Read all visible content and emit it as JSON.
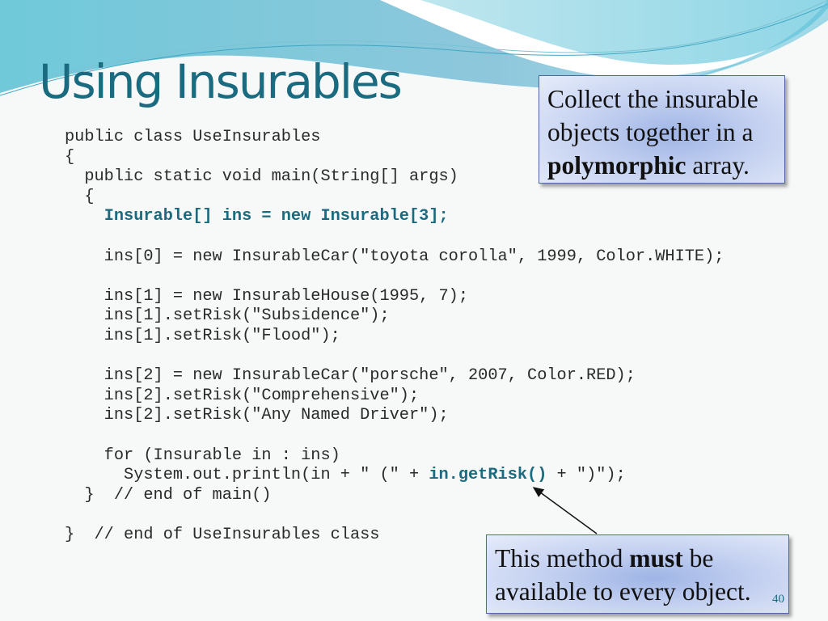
{
  "slide": {
    "title": "Using Insurables",
    "page_number": "40",
    "accent_color": "#1a6a80"
  },
  "code": {
    "lines": [
      {
        "pre": "public class UseInsurables",
        "hl": "",
        "post": ""
      },
      {
        "pre": "{",
        "hl": "",
        "post": ""
      },
      {
        "pre": "  public static void main(String[] args)",
        "hl": "",
        "post": ""
      },
      {
        "pre": "  {",
        "hl": "",
        "post": ""
      },
      {
        "pre": "    ",
        "hl": "Insurable[] ins = new Insurable[3];",
        "post": ""
      },
      {
        "pre": "",
        "hl": "",
        "post": ""
      },
      {
        "pre": "    ins[0] = new InsurableCar(\"toyota corolla\", 1999, Color.WHITE);",
        "hl": "",
        "post": ""
      },
      {
        "pre": "",
        "hl": "",
        "post": ""
      },
      {
        "pre": "    ins[1] = new InsurableHouse(1995, 7);",
        "hl": "",
        "post": ""
      },
      {
        "pre": "    ins[1].setRisk(\"Subsidence\");",
        "hl": "",
        "post": ""
      },
      {
        "pre": "    ins[1].setRisk(\"Flood\");",
        "hl": "",
        "post": ""
      },
      {
        "pre": "",
        "hl": "",
        "post": ""
      },
      {
        "pre": "    ins[2] = new InsurableCar(\"porsche\", 2007, Color.RED);",
        "hl": "",
        "post": ""
      },
      {
        "pre": "    ins[2].setRisk(\"Comprehensive\");",
        "hl": "",
        "post": ""
      },
      {
        "pre": "    ins[2].setRisk(\"Any Named Driver\");",
        "hl": "",
        "post": ""
      },
      {
        "pre": "",
        "hl": "",
        "post": ""
      },
      {
        "pre": "    for (Insurable in : ins)",
        "hl": "",
        "post": ""
      },
      {
        "pre": "      System.out.println(in + \" (\" + ",
        "hl": "in.getRisk()",
        "post": " + \")\");"
      },
      {
        "pre": "  }  // end of main()",
        "hl": "",
        "post": ""
      },
      {
        "pre": "",
        "hl": "",
        "post": ""
      },
      {
        "pre": "}  // end of UseInsurables class",
        "hl": "",
        "post": ""
      }
    ]
  },
  "callouts": {
    "top": {
      "line1": "Collect the insurable",
      "line2": "objects together in a",
      "bold": "polymorphic",
      "rest": " array."
    },
    "bottom": {
      "pre": "This method ",
      "bold": "must",
      "post": " be",
      "line2": "available to every object."
    }
  }
}
